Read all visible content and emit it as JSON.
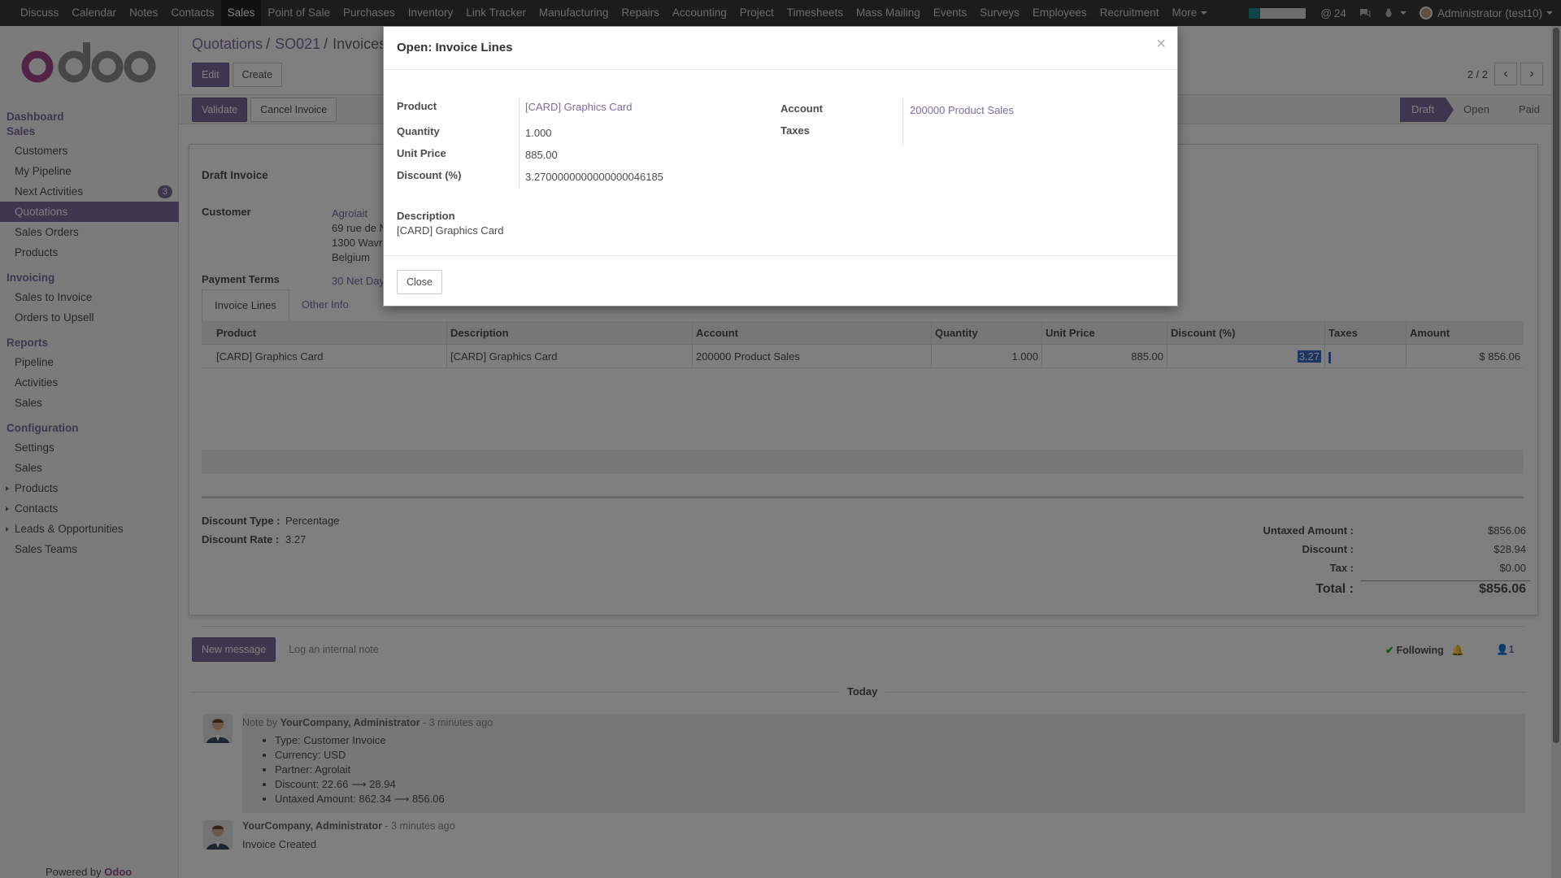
{
  "topbar": {
    "menu": [
      "Discuss",
      "Calendar",
      "Notes",
      "Contacts",
      "Sales",
      "Point of Sale",
      "Purchases",
      "Inventory",
      "Link Tracker",
      "Manufacturing",
      "Repairs",
      "Accounting",
      "Project",
      "Timesheets",
      "Mass Mailing",
      "Events",
      "Surveys",
      "Employees",
      "Recruitment"
    ],
    "active": "Sales",
    "more_label": "More",
    "progress_fraction": 0.2,
    "mentions_count": "24",
    "user": "Administrator (test10)"
  },
  "sidebar": {
    "sections": [
      {
        "head": "Dashboard",
        "items": []
      },
      {
        "head": "Sales",
        "items": [
          {
            "label": "Customers"
          },
          {
            "label": "My Pipeline"
          },
          {
            "label": "Next Activities",
            "badge": "3"
          },
          {
            "label": "Quotations",
            "active": true
          },
          {
            "label": "Sales Orders"
          },
          {
            "label": "Products"
          }
        ]
      },
      {
        "head": "Invoicing",
        "items": [
          {
            "label": "Sales to Invoice"
          },
          {
            "label": "Orders to Upsell"
          }
        ]
      },
      {
        "head": "Reports",
        "items": [
          {
            "label": "Pipeline"
          },
          {
            "label": "Activities"
          },
          {
            "label": "Sales"
          }
        ]
      },
      {
        "head": "Configuration",
        "items": [
          {
            "label": "Settings"
          },
          {
            "label": "Sales"
          },
          {
            "label": "Products",
            "expandable": true
          },
          {
            "label": "Contacts",
            "expandable": true
          },
          {
            "label": "Leads & Opportunities",
            "expandable": true
          },
          {
            "label": "Sales Teams"
          }
        ]
      }
    ],
    "powered_prefix": "Powered by",
    "powered_brand": "Odoo"
  },
  "breadcrumb": {
    "b1": "Quotations",
    "b2": "SO021",
    "b3": "Invoices"
  },
  "buttons": {
    "edit": "Edit",
    "create": "Create",
    "validate": "Validate",
    "cancel_invoice": "Cancel Invoice"
  },
  "pager": {
    "value": "2 / 2"
  },
  "stages": {
    "draft": "Draft",
    "open": "Open",
    "paid": "Paid"
  },
  "invoice": {
    "title": "Draft Invoice",
    "customer_label": "Customer",
    "customer_name": "Agrolait",
    "address1": "69 rue de Namur",
    "address2": "1300 Wavre",
    "address3": "Belgium",
    "terms_label": "Payment Terms",
    "terms": "30 Net Days",
    "tab_lines": "Invoice Lines",
    "tab_other": "Other Info",
    "headers": [
      "Product",
      "Description",
      "Account",
      "Quantity",
      "Unit Price",
      "Discount (%)",
      "Taxes",
      "Amount"
    ],
    "row": {
      "product": "[CARD] Graphics Card",
      "description": "[CARD] Graphics Card",
      "account": "200000 Product Sales",
      "quantity": "1.000",
      "unit_price": "885.00",
      "discount": "3.27",
      "amount": "$ 856.06"
    },
    "discount_type_label": "Discount Type :",
    "discount_type": "Percentage",
    "discount_rate_label": "Discount Rate :",
    "discount_rate": "3.27",
    "untaxed_label": "Untaxed Amount :",
    "untaxed": "$856.06",
    "discount_label": "Discount :",
    "discount_total": "$28.94",
    "tax_label": "Tax :",
    "tax": "$0.00",
    "total_label": "Total :",
    "total": "$856.06"
  },
  "chatter": {
    "new_message": "New message",
    "log_note": "Log an internal note",
    "following": "Following",
    "followers_count": "1",
    "today": "Today",
    "msg1": {
      "prefix": "Note by",
      "author": "YourCompany, Administrator",
      "time": "- 3 minutes ago",
      "lines": [
        "Type: Customer Invoice",
        "Currency: USD",
        "Partner: Agrolait",
        "Discount: 22.66 ⟶ 28.94",
        "Untaxed Amount: 862.34 ⟶ 856.06"
      ]
    },
    "msg2": {
      "author": "YourCompany, Administrator",
      "time": "- 3 minutes ago",
      "text": "Invoice Created"
    }
  },
  "modal": {
    "title": "Open: Invoice Lines",
    "close_x": "×",
    "product_label": "Product",
    "product": "[CARD] Graphics Card",
    "quantity_label": "Quantity",
    "quantity": "1.000",
    "unit_price_label": "Unit Price",
    "unit_price": "885.00",
    "discount_label": "Discount (%)",
    "discount": "3.2700000000000000046185",
    "account_label": "Account",
    "account": "200000 Product Sales",
    "taxes_label": "Taxes",
    "description_label": "Description",
    "description": "[CARD] Graphics Card",
    "close_button": "Close"
  }
}
